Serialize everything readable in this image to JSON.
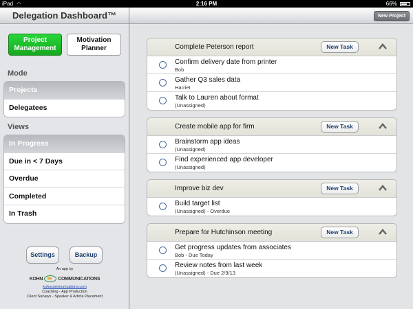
{
  "status_bar": {
    "carrier": "iPad",
    "time": "2:16 PM",
    "battery": "66%"
  },
  "sidebar": {
    "title": "Delegation Dashboard™",
    "segments": [
      {
        "label": "Project Management",
        "selected": true
      },
      {
        "label": "Motivation Planner",
        "selected": false
      }
    ],
    "mode_label": "Mode",
    "mode_items": [
      {
        "label": "Projects",
        "selected": true
      },
      {
        "label": "Delegatees",
        "selected": false
      }
    ],
    "views_label": "Views",
    "view_items": [
      {
        "label": "In Progress",
        "selected": true
      },
      {
        "label": "Due in < 7 Days",
        "selected": false
      },
      {
        "label": "Overdue",
        "selected": false
      },
      {
        "label": "Completed",
        "selected": false
      },
      {
        "label": "In Trash",
        "selected": false
      }
    ],
    "settings_label": "Settings",
    "backup_label": "Backup",
    "footer": {
      "app_by": "An app by",
      "logo_left": "KOHN",
      "logo_right": "COMMUNICATIONS",
      "link": "kohncommunications.com",
      "line1": "Coaching - App Production",
      "line2": "Client Surveys - Speaker & Article Placement"
    }
  },
  "main": {
    "new_project_label": "New Project",
    "new_task_label": "New Task",
    "projects": [
      {
        "title": "Complete Peterson report",
        "tasks": [
          {
            "title": "Confirm delivery date from printer",
            "sub": "Bob"
          },
          {
            "title": "Gather Q3 sales data",
            "sub": "Harriet"
          },
          {
            "title": "Talk to Lauren about format",
            "sub": "(Unassigned)"
          }
        ]
      },
      {
        "title": "Create mobile app for firm",
        "tasks": [
          {
            "title": "Brainstorm app ideas",
            "sub": "(Unassigned)"
          },
          {
            "title": "Find experienced app developer",
            "sub": "(Unassigned)"
          }
        ]
      },
      {
        "title": "Improve biz dev",
        "tasks": [
          {
            "title": "Build target list",
            "sub": "(Unassigned) - Overdue"
          }
        ]
      },
      {
        "title": "Prepare for Hutchinson meeting",
        "tasks": [
          {
            "title": "Get progress updates from associates",
            "sub": "Bob - Due Today"
          },
          {
            "title": "Review notes from last week",
            "sub": "(Unassigned) - Due 2/9/13"
          }
        ]
      }
    ]
  },
  "colors": {
    "accent_green": "#1fbf2c",
    "button_text": "#1f3f6e",
    "selected_row": "#b6b9be"
  }
}
